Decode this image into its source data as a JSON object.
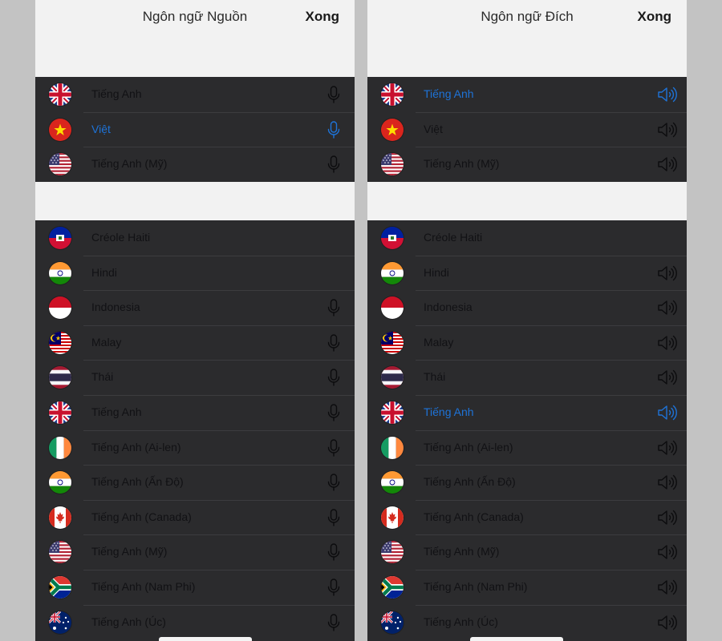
{
  "source": {
    "title": "Ngôn ngữ Nguồn",
    "done_label": "Xong",
    "recent": [
      {
        "label": "Tiếng Anh",
        "flag": "uk",
        "selected": false,
        "action": "mic"
      },
      {
        "label": "Việt",
        "flag": "vn",
        "selected": true,
        "action": "mic"
      },
      {
        "label": "Tiếng Anh (Mỹ)",
        "flag": "us",
        "selected": false,
        "action": "mic"
      }
    ],
    "all": [
      {
        "label": "Créole Haiti",
        "flag": "ht",
        "selected": false,
        "action": "none"
      },
      {
        "label": "Hindi",
        "flag": "in",
        "selected": false,
        "action": "none"
      },
      {
        "label": "Indonesia",
        "flag": "id",
        "selected": false,
        "action": "mic"
      },
      {
        "label": "Malay",
        "flag": "my",
        "selected": false,
        "action": "mic"
      },
      {
        "label": "Thái",
        "flag": "th",
        "selected": false,
        "action": "mic"
      },
      {
        "label": "Tiếng Anh",
        "flag": "uk",
        "selected": false,
        "action": "mic"
      },
      {
        "label": "Tiếng Anh (Ai-len)",
        "flag": "ie",
        "selected": false,
        "action": "mic"
      },
      {
        "label": "Tiếng Anh (Ấn Độ)",
        "flag": "in",
        "selected": false,
        "action": "mic"
      },
      {
        "label": "Tiếng Anh (Canada)",
        "flag": "ca",
        "selected": false,
        "action": "mic"
      },
      {
        "label": "Tiếng Anh (Mỹ)",
        "flag": "us",
        "selected": false,
        "action": "mic"
      },
      {
        "label": "Tiếng Anh (Nam Phi)",
        "flag": "za",
        "selected": false,
        "action": "mic"
      },
      {
        "label": "Tiếng Anh (Úc)",
        "flag": "au",
        "selected": false,
        "action": "mic"
      }
    ]
  },
  "target": {
    "title": "Ngôn ngữ Đích",
    "done_label": "Xong",
    "recent": [
      {
        "label": "Tiếng Anh",
        "flag": "uk",
        "selected": true,
        "action": "speaker"
      },
      {
        "label": "Việt",
        "flag": "vn",
        "selected": false,
        "action": "speaker"
      },
      {
        "label": "Tiếng Anh (Mỹ)",
        "flag": "us",
        "selected": false,
        "action": "speaker"
      }
    ],
    "all": [
      {
        "label": "Créole Haiti",
        "flag": "ht",
        "selected": false,
        "action": "none"
      },
      {
        "label": "Hindi",
        "flag": "in",
        "selected": false,
        "action": "speaker"
      },
      {
        "label": "Indonesia",
        "flag": "id",
        "selected": false,
        "action": "speaker"
      },
      {
        "label": "Malay",
        "flag": "my",
        "selected": false,
        "action": "speaker"
      },
      {
        "label": "Thái",
        "flag": "th",
        "selected": false,
        "action": "speaker"
      },
      {
        "label": "Tiếng Anh",
        "flag": "uk",
        "selected": true,
        "action": "speaker"
      },
      {
        "label": "Tiếng Anh (Ai-len)",
        "flag": "ie",
        "selected": false,
        "action": "speaker"
      },
      {
        "label": "Tiếng Anh (Ấn Độ)",
        "flag": "in",
        "selected": false,
        "action": "speaker"
      },
      {
        "label": "Tiếng Anh (Canada)",
        "flag": "ca",
        "selected": false,
        "action": "speaker"
      },
      {
        "label": "Tiếng Anh (Mỹ)",
        "flag": "us",
        "selected": false,
        "action": "speaker"
      },
      {
        "label": "Tiếng Anh (Nam Phi)",
        "flag": "za",
        "selected": false,
        "action": "speaker"
      },
      {
        "label": "Tiếng Anh (Úc)",
        "flag": "au",
        "selected": false,
        "action": "speaker"
      }
    ]
  },
  "colors": {
    "list_background": "#2b2b2d",
    "header_background": "#f2f2f2",
    "selected_text": "#1e73d8",
    "page_background": "#c3c3c3"
  }
}
